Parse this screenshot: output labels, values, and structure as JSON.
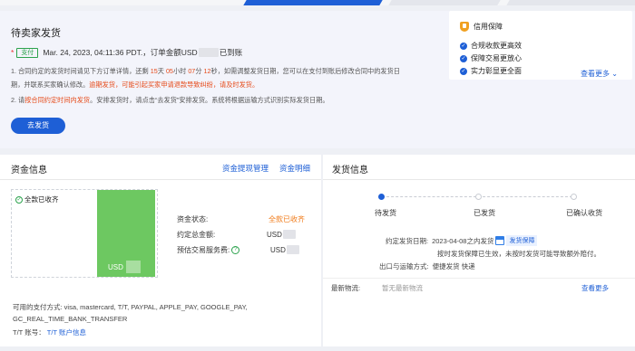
{
  "status": {
    "title": "待卖家发货",
    "badge": "支付",
    "paid_prefix": "Mar. 24, 2023, 04:11:36 PDT.，订单金额USD",
    "paid_suffix": "已到账",
    "note1": {
      "a": "1. 合同约定的发货时间请见下方订单详情，还剩 ",
      "days": "15",
      "b": "天 ",
      "hours": "05",
      "c": "小时 ",
      "mins": "07",
      "d": "分 ",
      "secs": "12",
      "e": "秒，如需调整发货日期，您可以在支付到账后修改合同中的发货日"
    },
    "note2": {
      "a": "期，并联系买家确认修改。",
      "b": "逾期发货，可能引起买家申请退款导致纠纷，请及时发货。"
    },
    "note3": {
      "a": "2. 请",
      "b": "按合同约定时间内发货",
      "c": "。安排发货时，请点击“去发货”安排发货。系统将根据运输方式识别实际发货日期。"
    },
    "ship_button": "去发货"
  },
  "credit": {
    "title": "信用保障",
    "items": [
      "合规收款更高效",
      "保障交易更放心",
      "实力彰显更全面"
    ],
    "more": "查看更多 ⌄"
  },
  "funds": {
    "title": "资金信息",
    "link1": "资金提现管理",
    "link2": "资金明细",
    "full_received": "全款已收齐",
    "bar_currency": "USD",
    "status_label": "资金状态:",
    "status_value": "全款已收齐",
    "total_label": "约定总金额:",
    "total_value": "USD",
    "fee_label": "预估交易服务费:",
    "fee_value": "USD",
    "fee_help": "?",
    "methods_label": "可用的支付方式: visa, mastercard, T/T, PAYPAL, APPLE_PAY, GOOGLE_PAY,",
    "methods_cont": "GC_REAL_TIME_BANK_TRANSFER",
    "tt_label": "T/T 账号：",
    "tt_link": "T/T 账户信息"
  },
  "shipping": {
    "title": "发货信息",
    "steps": [
      "待发货",
      "已发货",
      "已确认收货"
    ],
    "date_label": "约定发货日期:",
    "date_value": "2023-04-08之内发货",
    "guarantee_tag": "发货保障",
    "guarantee_note": "按时发货保障已生效，未按时发货可能导致额外赔付。",
    "method_label": "出口与运输方式:",
    "method_value": "便捷发货 快递",
    "latest_label": "最新物流:",
    "latest_value": "暂无最新物流",
    "more": "查看更多"
  },
  "colors": {
    "primary": "#1e5fd6",
    "green": "#6dc861",
    "orange": "#f07b1a",
    "red": "#e64a19"
  }
}
